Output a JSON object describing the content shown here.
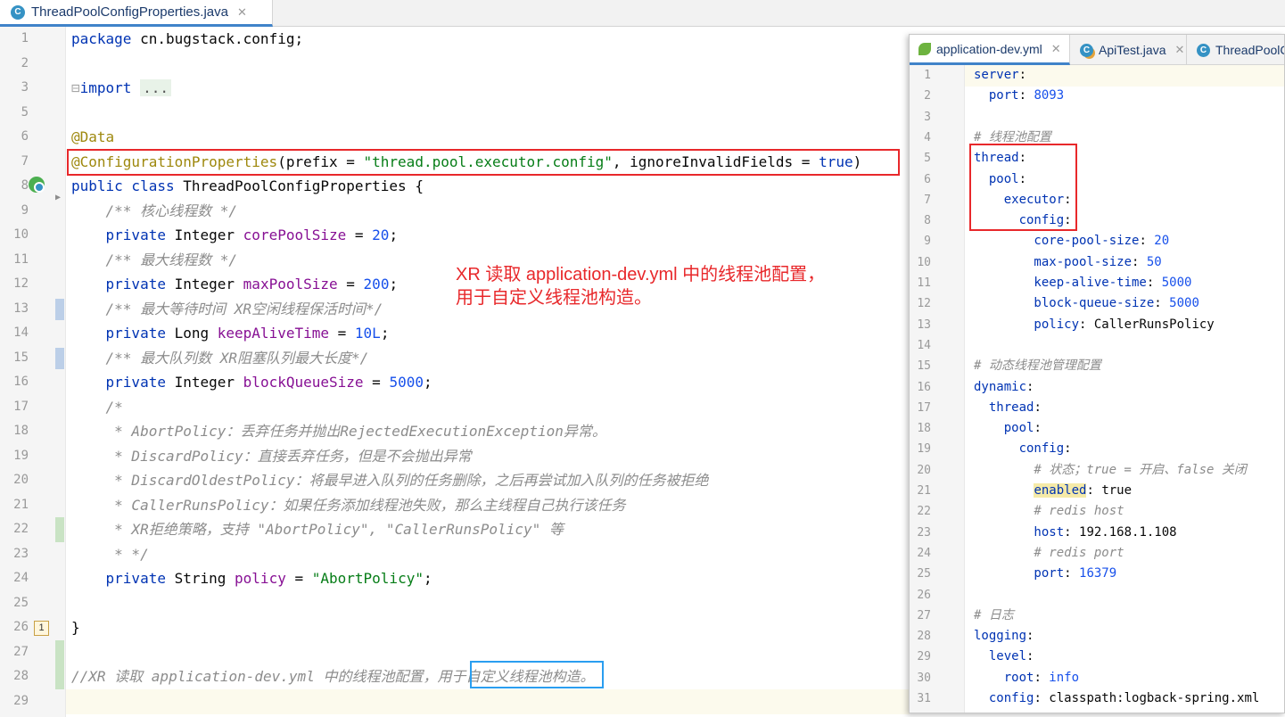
{
  "main_editor": {
    "tab": {
      "label": "ThreadPoolConfigProperties.java",
      "icon": "class-c-icon",
      "close_icon": "close-icon"
    },
    "lines": [
      {
        "n": "1"
      },
      {
        "n": "2"
      },
      {
        "n": "3"
      },
      {
        "n": "5"
      },
      {
        "n": "6"
      },
      {
        "n": "7"
      },
      {
        "n": "8"
      },
      {
        "n": "9"
      },
      {
        "n": "10"
      },
      {
        "n": "11"
      },
      {
        "n": "12"
      },
      {
        "n": "13"
      },
      {
        "n": "14"
      },
      {
        "n": "15"
      },
      {
        "n": "16"
      },
      {
        "n": "17"
      },
      {
        "n": "18"
      },
      {
        "n": "19"
      },
      {
        "n": "20"
      },
      {
        "n": "21"
      },
      {
        "n": "22"
      },
      {
        "n": "23"
      },
      {
        "n": "24"
      },
      {
        "n": "25"
      },
      {
        "n": "26"
      },
      {
        "n": "27"
      },
      {
        "n": "28"
      },
      {
        "n": "29"
      }
    ],
    "code": {
      "l1_kw": "package",
      "l1_rest": " cn.bugstack.config;",
      "l3_kw": "import",
      "l3_dots": "...",
      "l6": "@Data",
      "l7_ann": "@ConfigurationProperties",
      "l7_a": "(prefix = ",
      "l7_str": "\"thread.pool.executor.config\"",
      "l7_b": ", ignoreInvalidFields = ",
      "l7_true": "true",
      "l7_c": ")",
      "l8_kw": "public class",
      "l8_rest": " ThreadPoolConfigProperties {",
      "l9": "    /** 核心线程数 */",
      "l10_kw": "    private",
      "l10_ty": " Integer ",
      "l10_fld": "corePoolSize",
      "l10_eq": " = ",
      "l10_num": "20",
      "l10_end": ";",
      "l11": "    /** 最大线程数 */",
      "l12_kw": "    private",
      "l12_ty": " Integer ",
      "l12_fld": "maxPoolSize",
      "l12_eq": " = ",
      "l12_num": "200",
      "l12_end": ";",
      "l13": "    /** 最大等待时间 XR空闲线程保活时间*/",
      "l14_kw": "    private",
      "l14_ty": " Long ",
      "l14_fld": "keepAliveTime",
      "l14_eq": " = ",
      "l14_num": "10L",
      "l14_end": ";",
      "l15": "    /** 最大队列数 XR阻塞队列最大长度*/",
      "l16_kw": "    private",
      "l16_ty": " Integer ",
      "l16_fld": "blockQueueSize",
      "l16_eq": " = ",
      "l16_num": "5000",
      "l16_end": ";",
      "l17": "    /*",
      "l18": "     * AbortPolicy：丢弃任务并抛出RejectedExecutionException异常。",
      "l19": "     * DiscardPolicy：直接丢弃任务，但是不会抛出异常",
      "l20": "     * DiscardOldestPolicy：将最早进入队列的任务删除，之后再尝试加入队列的任务被拒绝",
      "l21": "     * CallerRunsPolicy：如果任务添加线程池失败，那么主线程自己执行该任务",
      "l22": "     * XR拒绝策略，支持 \"AbortPolicy\", \"CallerRunsPolicy\" 等",
      "l23": "     * */",
      "l24_kw": "    private",
      "l24_ty": " String ",
      "l24_fld": "policy",
      "l24_eq": " = ",
      "l24_str": "\"AbortPolicy\"",
      "l24_end": ";",
      "l26": "}",
      "l28": "//XR 读取 application-dev.yml 中的线程池配置，用于自定义线程池构造。"
    },
    "bookmark": "1"
  },
  "annotation": {
    "line1": "XR 读取 application-dev.yml 中的线程池配置，",
    "line2": "用于自定义线程池构造。"
  },
  "yml_window": {
    "tabs": [
      {
        "label": "application-dev.yml",
        "icon": "spring-leaf-icon"
      },
      {
        "label": "ApiTest.java",
        "icon": "test-class-icon"
      },
      {
        "label": "ThreadPoolC",
        "icon": "class-c-icon"
      }
    ],
    "close_icon": "close-icon",
    "lines": [
      {
        "n": "1"
      },
      {
        "n": "2"
      },
      {
        "n": "3"
      },
      {
        "n": "4"
      },
      {
        "n": "5"
      },
      {
        "n": "6"
      },
      {
        "n": "7"
      },
      {
        "n": "8"
      },
      {
        "n": "9"
      },
      {
        "n": "10"
      },
      {
        "n": "11"
      },
      {
        "n": "12"
      },
      {
        "n": "13"
      },
      {
        "n": "14"
      },
      {
        "n": "15"
      },
      {
        "n": "16"
      },
      {
        "n": "17"
      },
      {
        "n": "18"
      },
      {
        "n": "19"
      },
      {
        "n": "20"
      },
      {
        "n": "21"
      },
      {
        "n": "22"
      },
      {
        "n": "23"
      },
      {
        "n": "24"
      },
      {
        "n": "25"
      },
      {
        "n": "26"
      },
      {
        "n": "27"
      },
      {
        "n": "28"
      },
      {
        "n": "29"
      },
      {
        "n": "30"
      },
      {
        "n": "31"
      }
    ],
    "code": {
      "y1": "server",
      "y1c": ":",
      "y2k": "  port",
      "y2c": ": ",
      "y2v": "8093",
      "y4": "# 线程池配置",
      "y5": "thread",
      "y5c": ":",
      "y6": "  pool",
      "y6c": ":",
      "y7": "    executor",
      "y7c": ":",
      "y8": "      config",
      "y8c": ":",
      "y9k": "        core-pool-size",
      "y9c": ": ",
      "y9v": "20",
      "y10k": "        max-pool-size",
      "y10c": ": ",
      "y10v": "50",
      "y11k": "        keep-alive-time",
      "y11c": ": ",
      "y11v": "5000",
      "y12k": "        block-queue-size",
      "y12c": ": ",
      "y12v": "5000",
      "y13k": "        policy",
      "y13c": ": ",
      "y13v": "CallerRunsPolicy",
      "y15": "# 动态线程池管理配置",
      "y16": "dynamic",
      "y16c": ":",
      "y17": "  thread",
      "y17c": ":",
      "y18": "    pool",
      "y18c": ":",
      "y19": "      config",
      "y19c": ":",
      "y20": "        # 状态；true = 开启、false 关闭",
      "y21ind": "        ",
      "y21k": "enabled",
      "y21c": ": ",
      "y21v": "true",
      "y22": "        # redis host",
      "y23k": "        host",
      "y23c": ": ",
      "y23v": "192.168.1.108",
      "y24": "        # redis port",
      "y25k": "        port",
      "y25c": ": ",
      "y25v": "16379",
      "y27": "# 日志",
      "y28": "logging",
      "y28c": ":",
      "y29": "  level",
      "y29c": ":",
      "y30k": "    root",
      "y30c": ": ",
      "y30v": "info",
      "y31k": "  config",
      "y31c": ": ",
      "y31v": "classpath:logback-spring.xml"
    }
  }
}
